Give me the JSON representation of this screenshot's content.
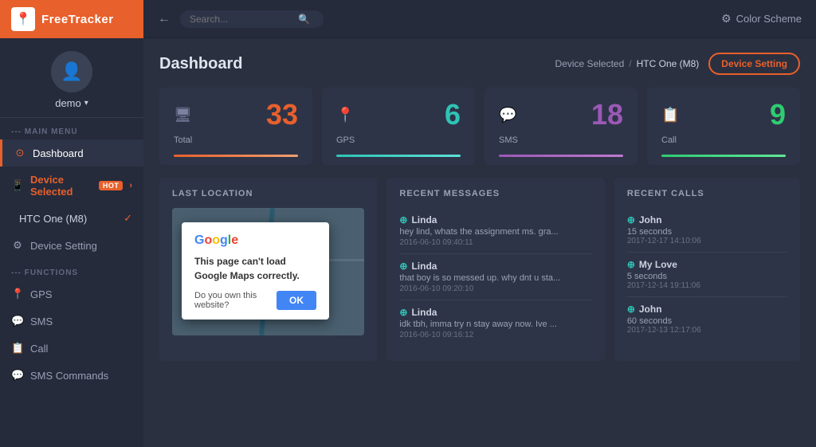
{
  "app": {
    "name": "FreeTracker"
  },
  "topbar": {
    "search_placeholder": "Search...",
    "color_scheme_label": "Color Scheme",
    "back_icon": "←"
  },
  "sidebar": {
    "user": {
      "name": "demo",
      "avatar_icon": "👤"
    },
    "main_menu_label": "--- MAIN MENU",
    "items": [
      {
        "id": "dashboard",
        "label": "Dashboard",
        "icon": "⊙",
        "active": true
      },
      {
        "id": "device-selected",
        "label": "Device Selected",
        "badge": "HOT",
        "icon": "📱"
      },
      {
        "id": "htc-device",
        "label": "HTC One (M8)",
        "check": true
      },
      {
        "id": "device-setting",
        "label": "Device Setting",
        "icon": "⚙"
      }
    ],
    "functions_label": "--- FUNCTIONS",
    "functions": [
      {
        "id": "gps",
        "label": "GPS",
        "icon": "📍"
      },
      {
        "id": "sms",
        "label": "SMS",
        "icon": "💬"
      },
      {
        "id": "call",
        "label": "Call",
        "icon": "📋"
      },
      {
        "id": "sms-commands",
        "label": "SMS Commands",
        "icon": "💬"
      }
    ]
  },
  "header": {
    "title": "Dashboard",
    "breadcrumb_device_selected": "Device Selected",
    "breadcrumb_separator": "/",
    "breadcrumb_device": "HTC One (M8)",
    "device_setting_btn": "Device Setting"
  },
  "stats": [
    {
      "id": "total",
      "icon": "🖥",
      "label": "Total",
      "value": "33",
      "bar_class": "bar-total",
      "val_class": "total-val"
    },
    {
      "id": "gps",
      "icon": "📍",
      "label": "GPS",
      "value": "6",
      "bar_class": "bar-gps",
      "val_class": "gps-val"
    },
    {
      "id": "sms",
      "icon": "💬",
      "label": "SMS",
      "value": "18",
      "bar_class": "bar-sms",
      "val_class": "sms-val"
    },
    {
      "id": "call",
      "icon": "📋",
      "label": "Call",
      "value": "9",
      "bar_class": "bar-call",
      "val_class": "call-val"
    }
  ],
  "last_location": {
    "title": "LAST LOCATION",
    "google_dialog": {
      "logo": "Google",
      "message": "This page can't load Google Maps correctly.",
      "question": "Do you own this website?",
      "ok_btn": "OK"
    }
  },
  "recent_messages": {
    "title": "RECENT MESSAGES",
    "items": [
      {
        "contact": "Linda",
        "preview": "hey lind, whats the assignment ms. gra...",
        "time": "2016-06-10 09:40:11"
      },
      {
        "contact": "Linda",
        "preview": "that boy is so messed up. why dnt u sta...",
        "time": "2016-06-10 09:20:10"
      },
      {
        "contact": "Linda",
        "preview": "idk tbh, imma try n stay away now. Ive ...",
        "time": "2016-06-10 09:16:12"
      }
    ]
  },
  "recent_calls": {
    "title": "RECENT CALLS",
    "items": [
      {
        "contact": "John",
        "duration": "15 seconds",
        "time": "2017-12-17 14:10:06"
      },
      {
        "contact": "My Love",
        "duration": "5 seconds",
        "time": "2017-12-14 19:11:06"
      },
      {
        "contact": "John",
        "duration": "60 seconds",
        "time": "2017-12-13 12:17:06"
      }
    ]
  }
}
